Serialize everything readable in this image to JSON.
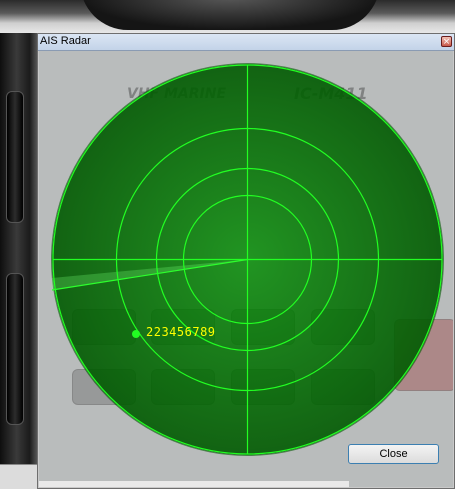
{
  "window": {
    "title": "AIS Radar",
    "close_label": "Close"
  },
  "icons": {
    "title_close": "close-icon",
    "target": "vessel-dot-icon"
  },
  "colors": {
    "radar_fill": "#008c00",
    "radar_lines": "#22ff22",
    "target_label": "#ffff00",
    "titlebar": "#c3d3e8"
  },
  "radar": {
    "target": {
      "mmsi": "223456789"
    }
  }
}
